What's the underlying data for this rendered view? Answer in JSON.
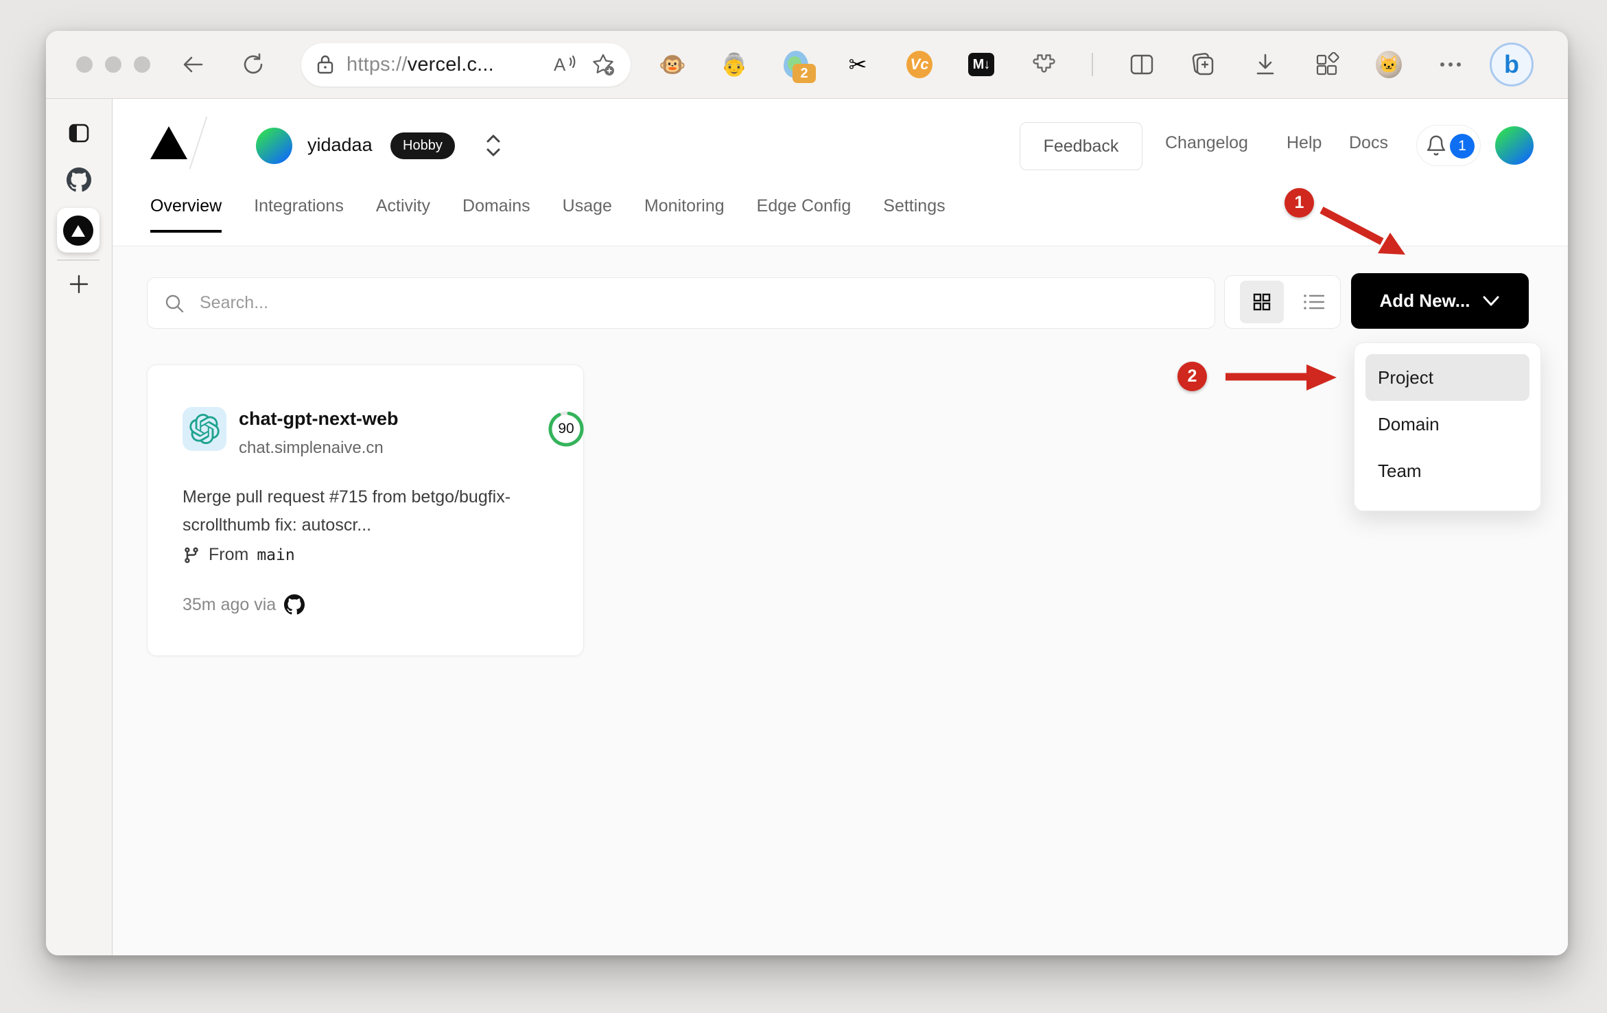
{
  "browser": {
    "url_scheme": "https://",
    "url_host": "vercel.c...",
    "extension_badge": "2",
    "vc_ext_label": "Vc",
    "markdown_ext_label": "M↓",
    "copilot_label": "b"
  },
  "header": {
    "team_name": "yidadaa",
    "plan_badge": "Hobby",
    "feedback_label": "Feedback",
    "changelog_label": "Changelog",
    "help_label": "Help",
    "docs_label": "Docs",
    "notification_count": "1"
  },
  "tabs": [
    {
      "label": "Overview",
      "active": true
    },
    {
      "label": "Integrations",
      "active": false
    },
    {
      "label": "Activity",
      "active": false
    },
    {
      "label": "Domains",
      "active": false
    },
    {
      "label": "Usage",
      "active": false
    },
    {
      "label": "Monitoring",
      "active": false
    },
    {
      "label": "Edge Config",
      "active": false
    },
    {
      "label": "Settings",
      "active": false
    }
  ],
  "controls": {
    "search_placeholder": "Search...",
    "add_new_label": "Add New..."
  },
  "add_new_menu": {
    "items": [
      {
        "label": "Project",
        "highlighted": true
      },
      {
        "label": "Domain",
        "highlighted": false
      },
      {
        "label": "Team",
        "highlighted": false
      }
    ]
  },
  "project_card": {
    "name": "chat-gpt-next-web",
    "domain": "chat.simplenaive.cn",
    "score": "90",
    "commit_message": "Merge pull request #715 from betgo/bugfix-scrollthumb fix: autoscr...",
    "branch_label": "From",
    "branch_name": "main",
    "deploy_meta": "35m ago via"
  },
  "annotations": {
    "step1": "1",
    "step2": "2"
  },
  "colors": {
    "accent_red": "#d0281e",
    "badge_blue": "#0e6ff2",
    "score_green": "#34b35b",
    "button_black": "#000000"
  }
}
